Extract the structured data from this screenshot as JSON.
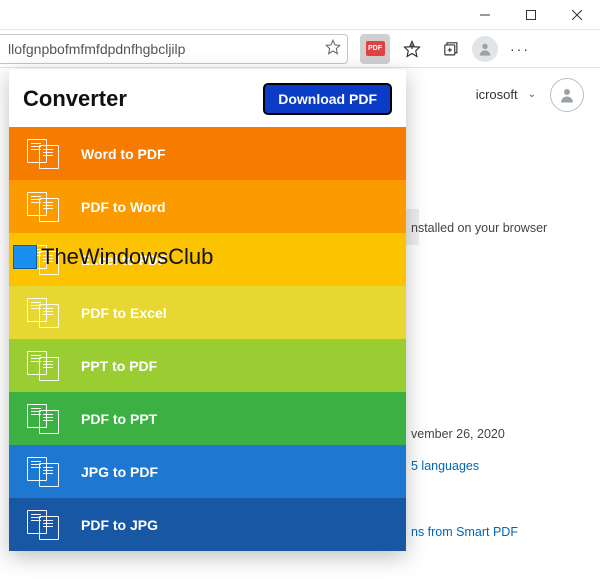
{
  "window": {
    "minimize": "–",
    "maximize": "▢",
    "close": "✕"
  },
  "toolbar": {
    "address": "llofgnpbofmfmfdpdnfhgbcljilp",
    "star": "☆",
    "pdf_chip": "PDF",
    "fav_star": "✩",
    "collections": "⧉",
    "more": "···"
  },
  "page": {
    "microsoft_label": "icrosoft",
    "installed_text": "nstalled on your browser",
    "date_text": "vember 26, 2020",
    "lang_link": "5 languages",
    "smart_link": "ns from Smart PDF"
  },
  "popup": {
    "title": "Converter",
    "download_label": "Download PDF",
    "options": [
      {
        "label": "Word to PDF"
      },
      {
        "label": "PDF to Word"
      },
      {
        "label": "Excel to PDF"
      },
      {
        "label": "PDF to Excel"
      },
      {
        "label": "PPT to PDF"
      },
      {
        "label": "PDF to PPT"
      },
      {
        "label": "JPG to PDF"
      },
      {
        "label": "PDF to JPG"
      }
    ]
  },
  "watermark": {
    "text": "TheWindowsClub"
  }
}
